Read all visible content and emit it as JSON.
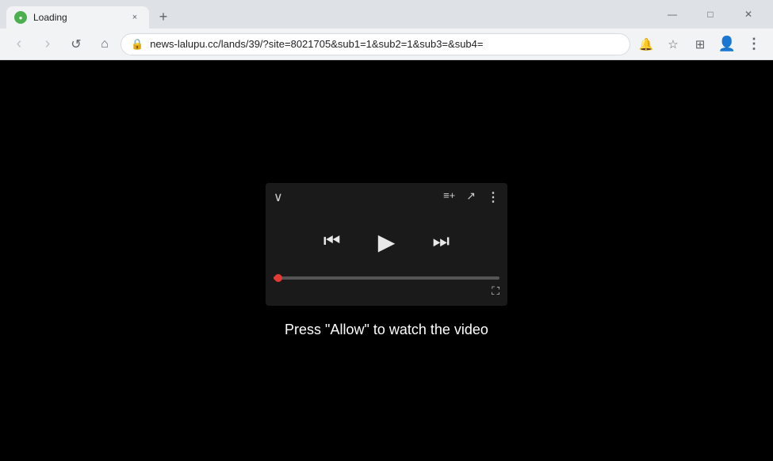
{
  "titlebar": {
    "tab": {
      "title": "Loading",
      "favicon_letter": "●",
      "close_label": "×"
    },
    "new_tab_label": "+",
    "controls": {
      "minimize": "—",
      "maximize": "□",
      "close": "✕"
    }
  },
  "toolbar": {
    "back_label": "‹",
    "forward_label": "›",
    "reload_label": "↺",
    "home_label": "⌂",
    "address": "news-lalupu.cc/lands/39/?site=8021705&sub1=1&sub2=1&sub3=&sub4=",
    "mute_label": "🔔",
    "bookmark_star": "☆",
    "extensions_label": "⊞",
    "profile_label": "👤",
    "menu_label": "⋮"
  },
  "player": {
    "chevron_down": "∨",
    "add_to_queue": "≡+",
    "share": "↗",
    "more": "⋮",
    "prev": "⏮",
    "play": "▶",
    "next": "⏭",
    "fullscreen": "⛶",
    "progress_percent": 2
  },
  "page": {
    "caption": "Press \"Allow\" to watch the video"
  }
}
